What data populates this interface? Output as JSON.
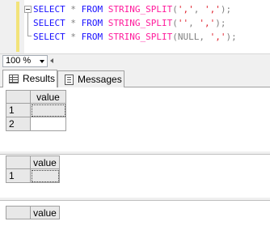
{
  "editor": {
    "lines": [
      {
        "kw1": "SELECT",
        "star": "*",
        "kw2": "FROM",
        "fn": "STRING_SPLIT",
        "open": "(",
        "arg1": "','",
        "comma": ",",
        "arg2": "','",
        "close": ");"
      },
      {
        "kw1": "SELECT",
        "star": "*",
        "kw2": "FROM",
        "fn": "STRING_SPLIT",
        "open": "(",
        "arg1": "''",
        "comma": ",",
        "arg2": "','",
        "close": ");"
      },
      {
        "kw1": "SELECT",
        "star": "*",
        "kw2": "FROM",
        "fn": "STRING_SPLIT",
        "open": "(",
        "arg1": "NULL",
        "comma": ",",
        "arg2": "','",
        "close": ");"
      }
    ]
  },
  "zoom": {
    "value": "100 %"
  },
  "tabs": [
    {
      "label": "Results",
      "icon": "grid-icon"
    },
    {
      "label": "Messages",
      "icon": "messages-icon"
    }
  ],
  "grids": [
    {
      "column": "value",
      "rows": [
        "1",
        "2"
      ]
    },
    {
      "column": "value",
      "rows": [
        "1"
      ]
    },
    {
      "column": "value",
      "rows": []
    }
  ]
}
